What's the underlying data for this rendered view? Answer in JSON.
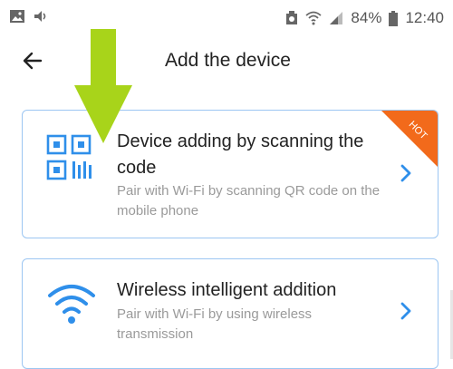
{
  "status_bar": {
    "battery_percent": "84%",
    "time": "12:40"
  },
  "header": {
    "title": "Add the device"
  },
  "cards": [
    {
      "title": "Device adding by scanning the code",
      "subtitle": "Pair with Wi-Fi by scanning QR code on the mobile phone",
      "badge": "HOT",
      "icon": "qr-code-icon"
    },
    {
      "title": "Wireless intelligent addition",
      "subtitle": "Pair with Wi-Fi by using wireless transmission",
      "icon": "wifi-icon"
    }
  ],
  "colors": {
    "accent": "#2f8fea",
    "badge": "#f26a1b",
    "arrow": "#a8d41a",
    "card_border": "#9cc6f2"
  }
}
